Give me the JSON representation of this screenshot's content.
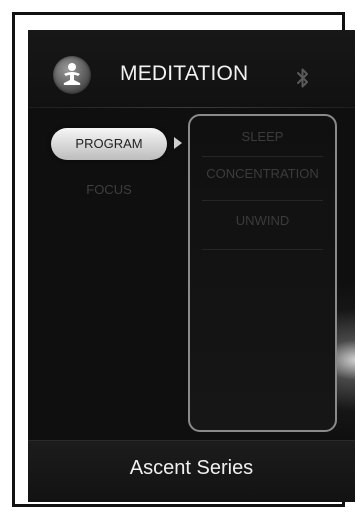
{
  "header": {
    "title": "MEDITATION",
    "app_icon": "meditation-figure-icon",
    "status_icon": "bluetooth-icon"
  },
  "nav": {
    "items": [
      {
        "label": "PROGRAM",
        "selected": true
      },
      {
        "label": "FOCUS",
        "selected": false
      }
    ]
  },
  "program_list": {
    "items": [
      {
        "label": "SLEEP"
      },
      {
        "label": "CONCENTRATION"
      },
      {
        "label": "UNWIND"
      }
    ]
  },
  "footer": {
    "label": "Ascent Series"
  },
  "colors": {
    "background": "#0f0f0f",
    "selected_pill": "#d9d9d9",
    "dim_text": "#3b3b3b",
    "panel_border": "#8a8a8a"
  }
}
